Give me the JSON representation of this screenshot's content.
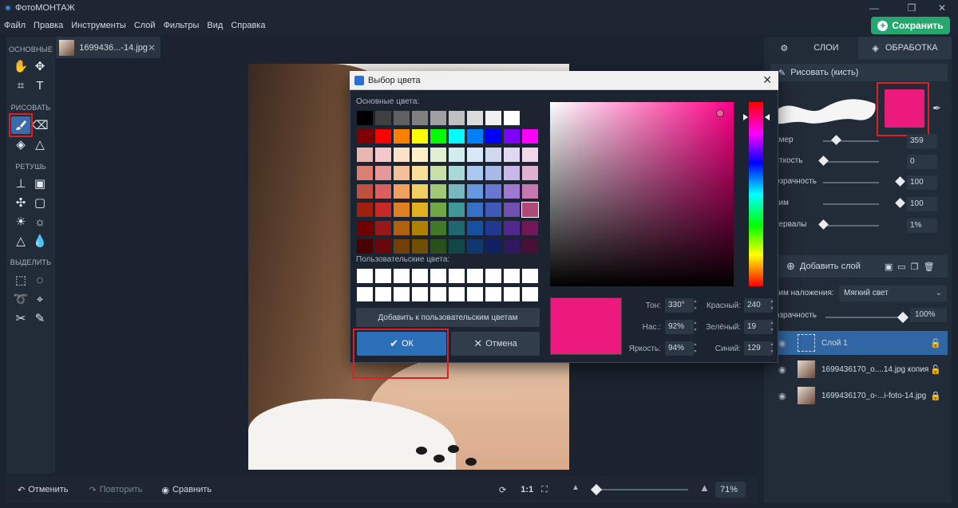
{
  "app": {
    "title": "ФотоМОНТАЖ"
  },
  "menu": [
    "Файл",
    "Правка",
    "Инструменты",
    "Слой",
    "Фильтры",
    "Вид",
    "Справка"
  ],
  "save_button": "Сохранить",
  "toolbar": {
    "sections": [
      "ОСНОВНЫЕ",
      "РИСОВАТЬ",
      "РЕТУШЬ",
      "ВЫДЕЛИТЬ"
    ]
  },
  "document_tab": {
    "name": "1699436...-14.jpg"
  },
  "bottom": {
    "undo": "Отменить",
    "redo": "Повторить",
    "compare": "Сравнить",
    "fit": "1:1",
    "zoom": "71%"
  },
  "right_panel": {
    "tabs": [
      "СЛОИ",
      "ОБРАБОТКА"
    ],
    "brush_title": "Рисовать (кисть)",
    "brush_color": "#ec1a7c",
    "params": [
      {
        "label": "змер",
        "value": "359"
      },
      {
        "label": "сткость",
        "value": "0"
      },
      {
        "label": "озрачность",
        "value": "100"
      },
      {
        "label": "ким",
        "value": "100"
      },
      {
        "label": "тервалы",
        "value": "1%"
      }
    ],
    "add_layer": "Добавить слой",
    "blend_label": "ким наложения:",
    "blend_value": "Мягкий свет",
    "opacity_label": "озрачность",
    "opacity_value": "100%",
    "layers": [
      {
        "name": "Слой 1"
      },
      {
        "name": "1699436170_o....14.jpg копия"
      },
      {
        "name": "1699436170_o-...i-foto-14.jpg"
      }
    ]
  },
  "color_dialog": {
    "title": "Выбор цвета",
    "basic_label": "Основные цвета:",
    "custom_label": "Пользовательские цвета:",
    "add_custom": "Добавить к пользовательским цветам",
    "ok": "ОК",
    "cancel": "Отмена",
    "current_color": "#ec1a7c",
    "hue_label": "Тон:",
    "hue": "330°",
    "sat_label": "Нас.:",
    "sat": "92%",
    "val_label": "Яркость:",
    "val": "94%",
    "red_label": "Красный:",
    "red": "240",
    "green_label": "Зелёный:",
    "green": "19",
    "blue_label": "Синий:",
    "blue": "129",
    "basic_colors": [
      [
        "#000000",
        "#404040",
        "#606060",
        "#808080",
        "#a0a0a0",
        "#c0c0c0",
        "#dcdcdc",
        "#f0f0f0",
        "#ffffff"
      ],
      [
        "#800000",
        "#ff0000",
        "#ff8000",
        "#ffff00",
        "#00ff00",
        "#00ffff",
        "#0080ff",
        "#0000ff",
        "#8000ff",
        "#ff00ff"
      ],
      [
        "#e9b7b0",
        "#f4c8c8",
        "#fbe1c8",
        "#fff0c8",
        "#e0f0d0",
        "#d0eef0",
        "#d8e8f8",
        "#d0d8f0",
        "#e0d8f0",
        "#f0d8e8"
      ],
      [
        "#d98070",
        "#e89898",
        "#f4c098",
        "#f8e098",
        "#c8e0a8",
        "#a8d8d8",
        "#a8c8f0",
        "#a8b8e8",
        "#c8b8e8",
        "#e0b0d0"
      ],
      [
        "#c05040",
        "#d86060",
        "#f0a060",
        "#f0d060",
        "#a0c878",
        "#78b8c0",
        "#6898e0",
        "#6878d0",
        "#a078d0",
        "#c878b0"
      ],
      [
        "#a02010",
        "#c82828",
        "#e08020",
        "#e0b020",
        "#70a848",
        "#409898",
        "#3870c8",
        "#4058b8",
        "#7050b0",
        "#a05080"
      ],
      [
        "#700000",
        "#981818",
        "#b06010",
        "#b08000",
        "#407828",
        "#206870",
        "#1850a0",
        "#203890",
        "#502890",
        "#701858"
      ],
      [
        "#480000",
        "#680808",
        "#704008",
        "#705000",
        "#285018",
        "#104848",
        "#103870",
        "#102060",
        "#301860",
        "#481038"
      ]
    ]
  }
}
